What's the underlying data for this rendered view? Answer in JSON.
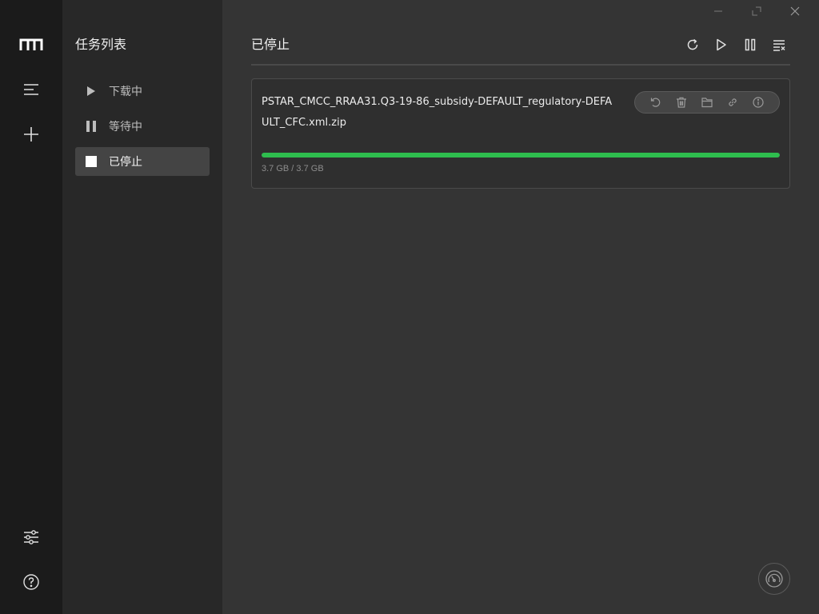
{
  "rail": {
    "items": [
      {
        "name": "logo",
        "icon": "logo-icon"
      },
      {
        "name": "menu",
        "icon": "menu-icon"
      },
      {
        "name": "add",
        "icon": "plus-icon"
      },
      {
        "name": "settings",
        "icon": "sliders-icon"
      },
      {
        "name": "help",
        "icon": "help-icon"
      }
    ]
  },
  "task_panel": {
    "title": "任务列表",
    "items": [
      {
        "label": "下载中",
        "icon": "play-icon",
        "active": false
      },
      {
        "label": "等待中",
        "icon": "pause-icon",
        "active": false
      },
      {
        "label": "已停止",
        "icon": "stop-icon",
        "active": true
      }
    ]
  },
  "main": {
    "title": "已停止",
    "toolbar": [
      "refresh-icon",
      "play-icon",
      "pause-icon",
      "clear-list-icon"
    ],
    "window_controls": [
      "minimize-icon",
      "maximize-icon",
      "close-icon"
    ]
  },
  "task": {
    "name": "PSTAR_CMCC_RRAA31.Q3-19-86_subsidy-DEFAULT_regulatory-DEFAULT_CFC.xml.zip",
    "size_text": "3.7 GB / 3.7 GB",
    "progress": 1.0,
    "actions": [
      "restart-icon",
      "delete-icon",
      "folder-icon",
      "link-icon",
      "info-icon"
    ]
  },
  "colors": {
    "progress": "#2ebd4e",
    "rail_bg": "#1b1b1b",
    "panel_bg": "#282828",
    "main_bg": "#343434"
  }
}
